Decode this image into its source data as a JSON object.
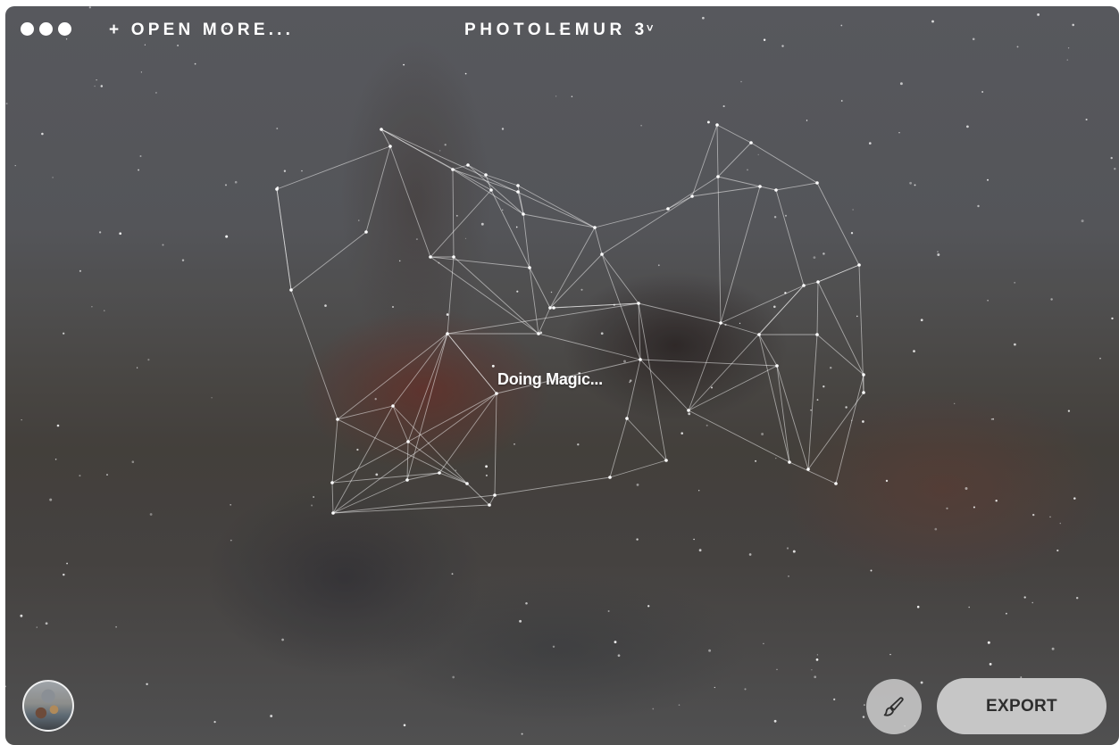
{
  "window": {
    "title": "PHOTOLEMUR 3",
    "title_caret": "˅"
  },
  "toolbar": {
    "open_more_label": "+ OPEN MORE..."
  },
  "status": {
    "processing_text": "Doing Magic..."
  },
  "actions": {
    "export_label": "EXPORT",
    "brush_icon": "brush-icon"
  },
  "colors": {
    "button_bg": "#d7d7d7",
    "export_text": "#2e2e2e",
    "ui_text": "#ffffff"
  }
}
